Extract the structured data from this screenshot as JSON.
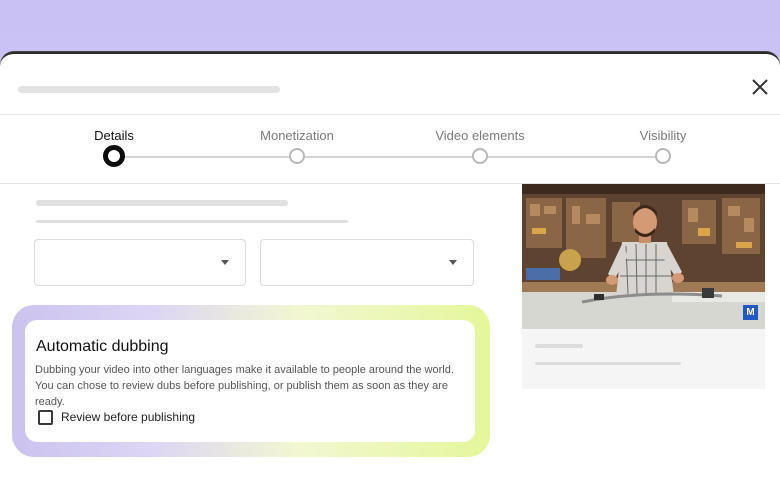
{
  "dialog": {
    "close_icon": "close-icon"
  },
  "stepper": {
    "steps": [
      {
        "label": "Details",
        "active": true
      },
      {
        "label": "Monetization",
        "active": false
      },
      {
        "label": "Video elements",
        "active": false
      },
      {
        "label": "Visibility",
        "active": false
      }
    ]
  },
  "form": {
    "select_left_icon": "chevron-down-icon",
    "select_right_icon": "chevron-down-icon"
  },
  "dubbing": {
    "title": "Automatic dubbing",
    "description": "Dubbing your video into other languages make it available to people around the world. You can chose to review dubs before publishing, or publish them as soon as they are ready.",
    "checkbox_label": "Review before publishing",
    "checked": false
  },
  "video": {
    "badge": "M"
  },
  "colors": {
    "background": "#c9c1f4",
    "active_step": "#0c0c0c",
    "glow_start": "#cbc3ef",
    "glow_end": "#e4f79a",
    "badge": "#2358c9"
  }
}
